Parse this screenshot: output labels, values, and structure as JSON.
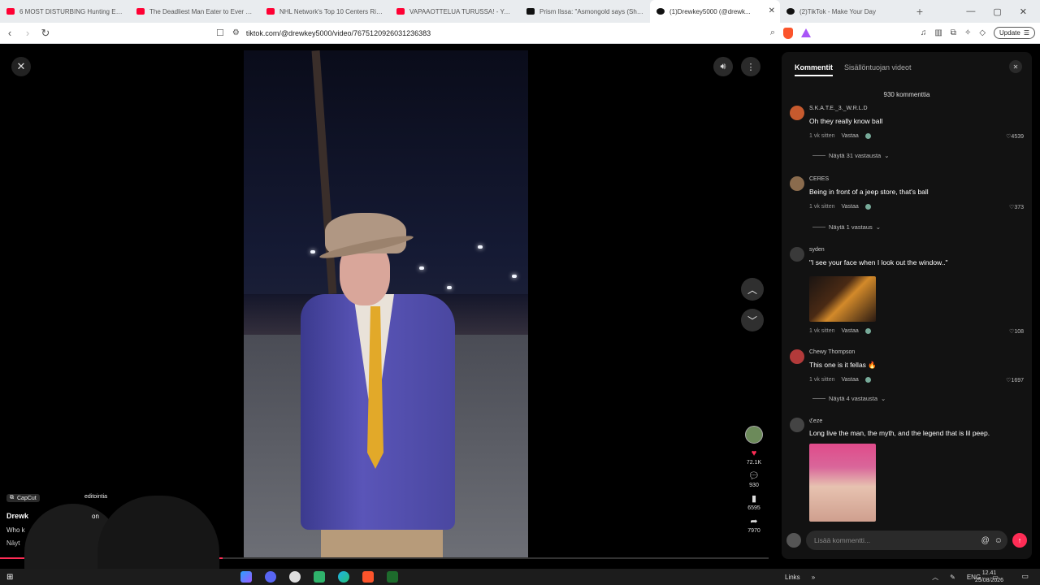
{
  "browser": {
    "tabs": [
      {
        "title": "6 MOST DISTURBING Hunting Enco...",
        "favicon": "youtube-icon"
      },
      {
        "title": "The Deadliest Man Eater to Ever Exis...",
        "favicon": "youtube-icon"
      },
      {
        "title": "NHL Network's Top 10 Centers Right...",
        "favicon": "youtube-icon"
      },
      {
        "title": "VAPAAOTTELUA TURUSSA! - YouTub...",
        "favicon": "youtube-icon"
      },
      {
        "title": "Prism Ilssa: \"Asmongold says (Sho...",
        "favicon": "x-icon"
      },
      {
        "title": "(1)Drewkey5000 (@drewk...",
        "favicon": "tiktok-icon",
        "active": true
      },
      {
        "title": "(2)TikTok - Make Your Day",
        "favicon": "tiktok-icon"
      }
    ],
    "url": "tiktok.com/@drewkey5000/video/7675120926031236383",
    "update_label": "Update"
  },
  "video": {
    "likes": "72.1K",
    "comments": "930",
    "saves": "6595",
    "shares": "7970",
    "progress_fraction": 0.29
  },
  "overlay": {
    "capcut_label": "CapCut",
    "capcut_right": "editointia",
    "author": "Drewk",
    "author_suffix": "on",
    "desc_start": "Who k",
    "more_start": "Näyt"
  },
  "panel": {
    "tab_comments": "Kommentit",
    "tab_creator_videos": "Sisällöntuojan videot",
    "count_label": "930 kommenttia",
    "comments": [
      {
        "user": "S.K.A.T.E._3._W.R.L.D",
        "text": "Oh they really know ball",
        "time": "1 vk sitten",
        "reply": "Vastaa",
        "likes": "4539",
        "more": "Näytä 31 vastausta"
      },
      {
        "user": "CERES",
        "text": "Being in front of a jeep store, that's ball",
        "time": "1 vk sitten",
        "reply": "Vastaa",
        "likes": "373",
        "more": "Näytä 1 vastaus"
      },
      {
        "user": "syden",
        "text": "\"I see your face when I look out the window..\"",
        "time": "1 vk sitten",
        "reply": "Vastaa",
        "likes": "108"
      },
      {
        "user": "Chewy Thompson",
        "text": "This one is it fellas 🔥",
        "time": "1 vk sitten",
        "reply": "Vastaa",
        "likes": "1697",
        "more": "Näytä 4 vastausta"
      },
      {
        "user": "ℭeze",
        "text": "Long live the man, the myth, and the legend that is lil peep."
      }
    ],
    "input_placeholder": "Lisää kommentti..."
  },
  "taskbar": {
    "links_label": "Links",
    "lang": "ENG",
    "time": "12.41",
    "date": "25/08/2026"
  },
  "colors": {
    "accent": "#fe2c55",
    "panel_bg": "#121212",
    "youtube": "#ff0033"
  }
}
